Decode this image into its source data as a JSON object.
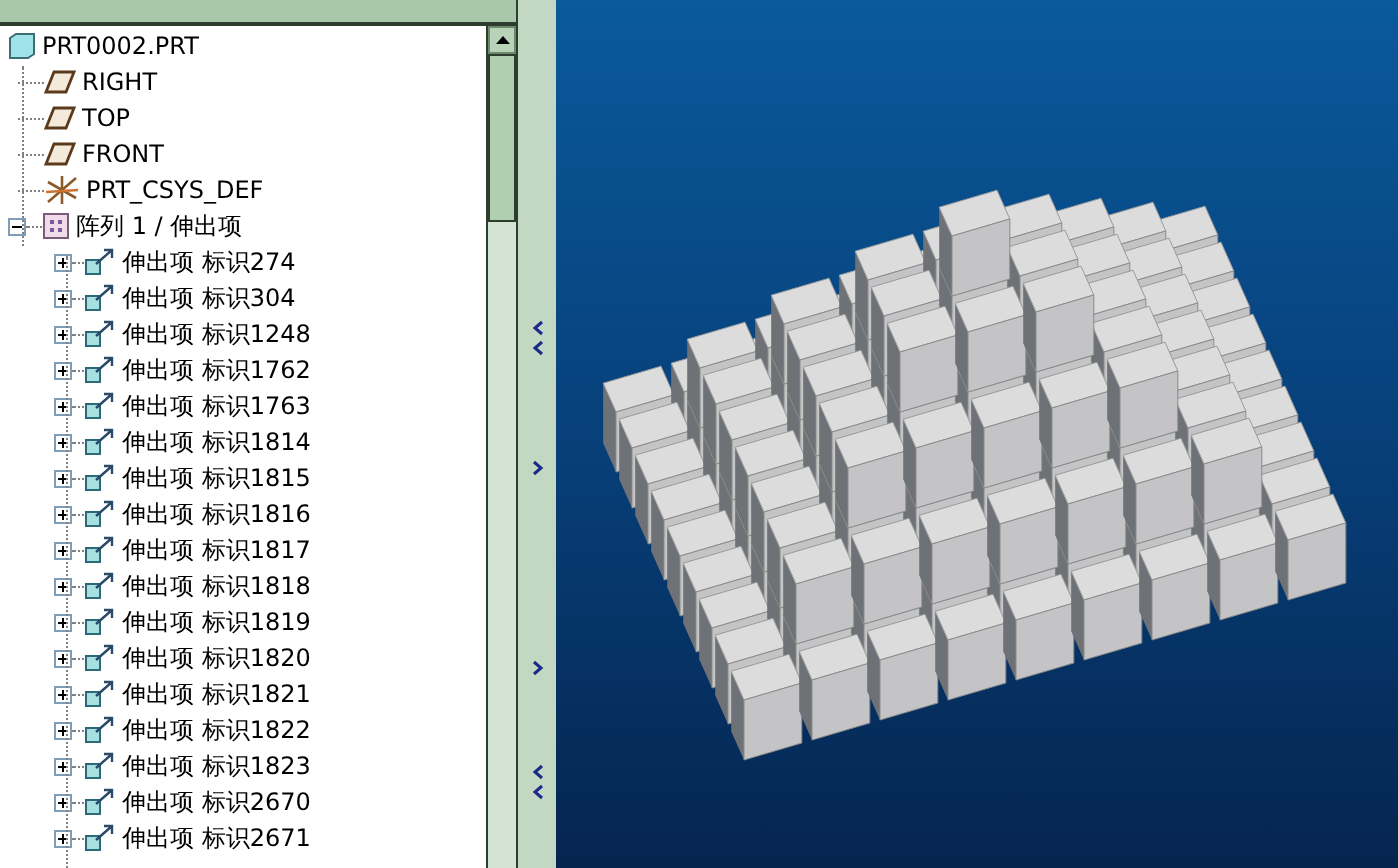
{
  "model_tree": {
    "root": {
      "label": "PRT0002.PRT",
      "kind": "part",
      "children": [
        {
          "label": "RIGHT",
          "kind": "plane"
        },
        {
          "label": "TOP",
          "kind": "plane"
        },
        {
          "label": "FRONT",
          "kind": "plane"
        },
        {
          "label": "PRT_CSYS_DEF",
          "kind": "csys"
        },
        {
          "label": "阵列 1 / 伸出项",
          "kind": "pattern",
          "expanded": true,
          "children": [
            {
              "label": "伸出项 标识274",
              "kind": "protrusion",
              "expanded": false
            },
            {
              "label": "伸出项 标识304",
              "kind": "protrusion",
              "expanded": false
            },
            {
              "label": "伸出项 标识1248",
              "kind": "protrusion",
              "expanded": false
            },
            {
              "label": "伸出项 标识1762",
              "kind": "protrusion",
              "expanded": false
            },
            {
              "label": "伸出项 标识1763",
              "kind": "protrusion",
              "expanded": false
            },
            {
              "label": "伸出项 标识1814",
              "kind": "protrusion",
              "expanded": false
            },
            {
              "label": "伸出项 标识1815",
              "kind": "protrusion",
              "expanded": false
            },
            {
              "label": "伸出项 标识1816",
              "kind": "protrusion",
              "expanded": false
            },
            {
              "label": "伸出项 标识1817",
              "kind": "protrusion",
              "expanded": false
            },
            {
              "label": "伸出项 标识1818",
              "kind": "protrusion",
              "expanded": false
            },
            {
              "label": "伸出项 标识1819",
              "kind": "protrusion",
              "expanded": false
            },
            {
              "label": "伸出项 标识1820",
              "kind": "protrusion",
              "expanded": false
            },
            {
              "label": "伸出项 标识1821",
              "kind": "protrusion",
              "expanded": false
            },
            {
              "label": "伸出项 标识1822",
              "kind": "protrusion",
              "expanded": false
            },
            {
              "label": "伸出项 标识1823",
              "kind": "protrusion",
              "expanded": false
            },
            {
              "label": "伸出项 标识2670",
              "kind": "protrusion",
              "expanded": false
            },
            {
              "label": "伸出项 标识2671",
              "kind": "protrusion",
              "expanded": false
            }
          ]
        }
      ]
    }
  }
}
